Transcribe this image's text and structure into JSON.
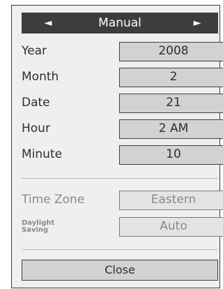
{
  "header": {
    "title": "Manual",
    "left_arrow": "◄",
    "right_arrow": "►"
  },
  "settings": [
    {
      "label": "Year",
      "value": "2008"
    },
    {
      "label": "Month",
      "value": "2"
    },
    {
      "label": "Date",
      "value": "21"
    },
    {
      "label": "Hour",
      "value": "2 AM"
    },
    {
      "label": "Minute",
      "value": "10"
    }
  ],
  "time_zone": {
    "label": "Time Zone",
    "value": "Eastern"
  },
  "daylight_saving": {
    "label_line1": "Daylight",
    "label_line2": "Saving",
    "value": "Auto"
  },
  "close_label": "Close"
}
